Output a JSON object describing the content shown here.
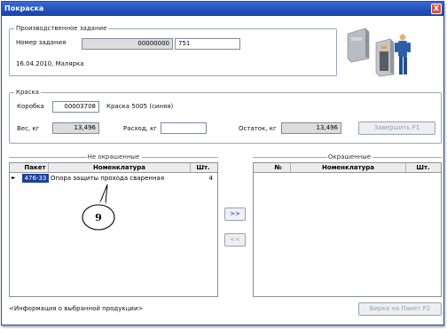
{
  "window": {
    "title": "Покраска",
    "close_label": "X"
  },
  "task": {
    "group_label": "Производственное задание",
    "number_label": "Номер задания",
    "number_value": "00000000",
    "number_suffix": "751",
    "info": "16.04.2010, Маляр­ка"
  },
  "paint": {
    "group_label": "Краска",
    "box_label": "Коробка",
    "box_value": "00003708",
    "paint_name": "Краска 5005 (синяя)",
    "weight_label": "Вес, кг",
    "weight_value": "13,496",
    "consumption_label": "Расход, кг",
    "consumption_value": "",
    "remain_label": "Остаток, кг",
    "remain_value": "13,496",
    "finish_button": "Завершить     F1"
  },
  "unpainted": {
    "title": "Не окрашенные",
    "columns": [
      "Пакет",
      "Номенклатура",
      "Шт."
    ],
    "rows": [
      {
        "package": "476-33",
        "name": "Опора защиты прохода сваренная",
        "qty": "4"
      }
    ]
  },
  "painted": {
    "title": "Окрашенные",
    "columns": [
      "№",
      "Номенклатура",
      "Шт."
    ]
  },
  "transfer": {
    "forward": ">>",
    "back": "<<"
  },
  "callout": {
    "label": "9"
  },
  "footer": {
    "info": "<Информация о выбранной продукции>",
    "tag_button": "Бирка на Пакет    F2"
  }
}
